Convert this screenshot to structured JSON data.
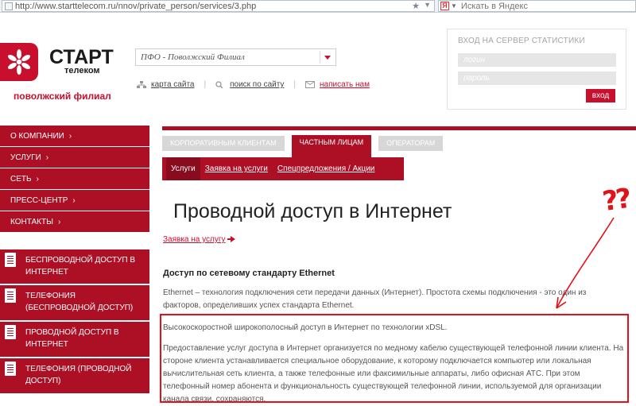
{
  "browser": {
    "url": "http://www.starttelecom.ru/nnov/private_person/services/3.php",
    "search_placeholder": "Искать в Яндекс",
    "yandex_letter": "Я"
  },
  "logo": {
    "brand": "СТАРТ",
    "sub": "телеком",
    "branch": "поволжский филиал"
  },
  "branch_select": {
    "value": "ПФО - Поволжский Филиал"
  },
  "util_links": {
    "sitemap": "карта сайта",
    "search": "поиск по сайту",
    "write": "написать нам"
  },
  "login": {
    "title": "ВХОД НА СЕРВЕР СТАТИСТИКИ",
    "login_placeholder": "логин",
    "password_placeholder": "пароль",
    "enter": "вход"
  },
  "left_menu": [
    {
      "label": "О КОМПАНИИ"
    },
    {
      "label": "УСЛУГИ"
    },
    {
      "label": "СЕТЬ"
    },
    {
      "label": "ПРЕСС-ЦЕНТР"
    },
    {
      "label": "КОНТАКТЫ"
    }
  ],
  "chevron": "›",
  "services": [
    {
      "label": "Беспроводной доступ в Интернет"
    },
    {
      "label": "Телефония (беспроводной доступ)"
    },
    {
      "label": "Проводной доступ в Интернет"
    },
    {
      "label": "Телефония (проводной доступ)"
    }
  ],
  "tabs": [
    {
      "label": "КОРПОРАТИВНЫМ КЛИЕНТАМ"
    },
    {
      "label": "ЧАСТНЫМ ЛИЦАМ"
    },
    {
      "label": "ОПЕРАТОРАМ"
    }
  ],
  "sub_tabs": [
    {
      "label": "Услуги"
    },
    {
      "label": "Заявка на услуги"
    },
    {
      "label": "Спецпредложения / Акции"
    }
  ],
  "content": {
    "title": "Проводной доступ в Интернет",
    "order_link": "Заявка на услугу",
    "section_title": "Доступ по сетевому стандарту Ethernet",
    "p1": "Ethernet – технология подключения сети передачи данных (Интернет). Простота схемы подключения - это один из факторов, определивших успех стандарта Ethernet.",
    "p2": "Высокоскоростной широкополосный доступ в Интернет по технологии xDSL.",
    "p3": "Предоставление услуг доступа в Интернет организуется по медному кабелю существующей телефонной линии клиента. На стороне клиента устанавливается специальное оборудование, к которому подключается компьютер или локальная вычислительная сеть клиента, а также телефонные или факсимильные аппараты, либо офисная АТС. При этом телефонный номер абонента и функциональность существующей телефонной линии, используемой для организации канала связи, сохраняются."
  },
  "annotation": {
    "text": "??"
  },
  "colors": {
    "brand_red": "#ad0f25",
    "annotation_red": "#e0121a"
  }
}
